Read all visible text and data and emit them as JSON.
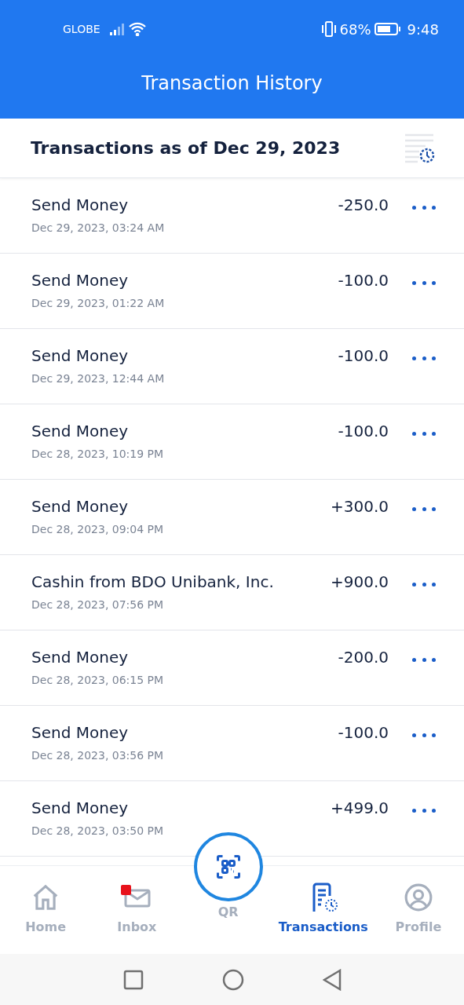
{
  "status_bar": {
    "carrier": "GLOBE",
    "battery_percent": "68%",
    "time": "9:48"
  },
  "header": {
    "title": "Transaction History"
  },
  "subheader": {
    "title": "Transactions as of Dec 29, 2023"
  },
  "transactions": [
    {
      "title": "Send Money",
      "date": "Dec 29, 2023, 03:24 AM",
      "amount": "-250.0"
    },
    {
      "title": "Send Money",
      "date": "Dec 29, 2023, 01:22 AM",
      "amount": "-100.0"
    },
    {
      "title": "Send Money",
      "date": "Dec 29, 2023, 12:44 AM",
      "amount": "-100.0"
    },
    {
      "title": "Send Money",
      "date": "Dec 28, 2023, 10:19 PM",
      "amount": "-100.0"
    },
    {
      "title": "Send Money",
      "date": "Dec 28, 2023, 09:04 PM",
      "amount": "+300.0"
    },
    {
      "title": "Cashin from BDO Unibank, Inc.",
      "date": "Dec 28, 2023, 07:56 PM",
      "amount": "+900.0"
    },
    {
      "title": "Send Money",
      "date": "Dec 28, 2023, 06:15 PM",
      "amount": "-200.0"
    },
    {
      "title": "Send Money",
      "date": "Dec 28, 2023, 03:56 PM",
      "amount": "-100.0"
    },
    {
      "title": "Send Money",
      "date": "Dec 28, 2023, 03:50 PM",
      "amount": "+499.0"
    }
  ],
  "bottom_nav": [
    {
      "kind": "home",
      "label": "Home",
      "selected": false
    },
    {
      "kind": "inbox",
      "label": "Inbox",
      "selected": false,
      "notification": true
    },
    {
      "kind": "qr",
      "label": "QR",
      "selected": false
    },
    {
      "kind": "transactions",
      "label": "Transactions",
      "selected": true
    },
    {
      "kind": "profile",
      "label": "Profile",
      "selected": false
    }
  ]
}
